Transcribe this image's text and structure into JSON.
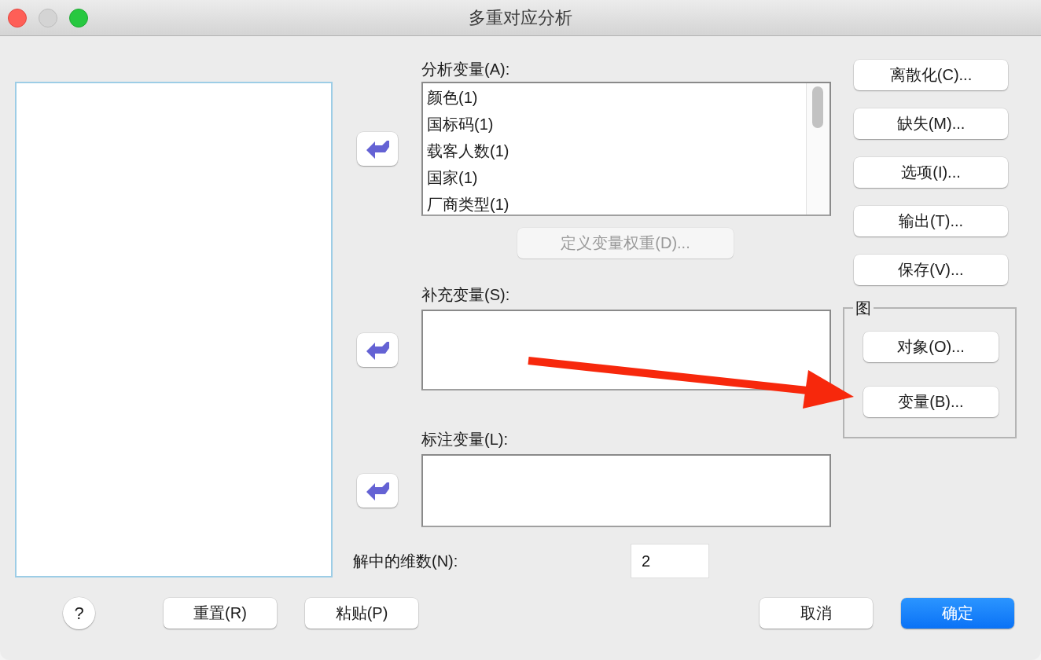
{
  "window": {
    "title": "多重对应分析"
  },
  "source_list": {
    "focused": true
  },
  "variable_boxes": [
    {
      "label": "分析变量(A):",
      "items": [
        "颜色(1)",
        "国标码(1)",
        "载客人数(1)",
        "国家(1)",
        "厂商类型(1)"
      ]
    },
    {
      "label": "补充变量(S):"
    },
    {
      "label": "标注变量(L):"
    }
  ],
  "weight_button": {
    "label": "定义变量权重(D)...",
    "disabled": true
  },
  "dimensions": {
    "label": "解中的维数(N):",
    "value": "2"
  },
  "side_buttons": [
    "离散化(C)...",
    "缺失(M)...",
    "选项(I)...",
    "输出(T)...",
    "保存(V)..."
  ],
  "plots_group": {
    "title": "图",
    "buttons": [
      "对象(O)...",
      "变量(B)..."
    ]
  },
  "help_button": "?",
  "footer_left": [
    {
      "label": "重置(R)",
      "default": false
    },
    {
      "label": "粘贴(P)",
      "default": false
    }
  ],
  "footer_right": [
    {
      "label": "取消",
      "default": false
    },
    {
      "label": "确定",
      "default": true
    }
  ]
}
